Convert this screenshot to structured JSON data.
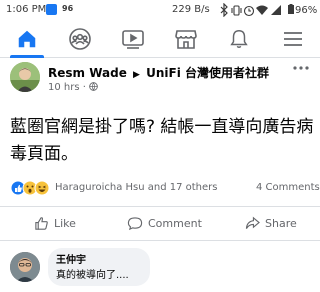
{
  "status_bar": {
    "time": "1:06 PM",
    "badge": "96",
    "speed": "229 B/s",
    "battery": "96%"
  },
  "nav": {
    "items": [
      {
        "name": "home-icon",
        "active": true
      },
      {
        "name": "groups-icon",
        "active": false
      },
      {
        "name": "watch-icon",
        "active": false
      },
      {
        "name": "marketplace-icon",
        "active": false
      },
      {
        "name": "notifications-icon",
        "active": false
      },
      {
        "name": "menu-icon",
        "active": false
      }
    ],
    "accent_color": "#1877f2"
  },
  "post": {
    "author": "Resm Wade",
    "group": "UniFi 台灣使用者社群",
    "time": "10 hrs",
    "separator": "·",
    "visibility_icon": "globe-icon",
    "text": "藍圈官網是掛了嗎? 結帳一直導向廣告病毒頁面。",
    "reactions": {
      "icons": [
        "like-icon",
        "wow-icon",
        "haha-icon"
      ],
      "names": "Haraguroicha Hsu and 17 others"
    },
    "comments_count": "4 Comments",
    "actions": {
      "like": "Like",
      "comment": "Comment",
      "share": "Share"
    }
  },
  "comment": {
    "author": "王仲宇",
    "text": "真的被導向了...."
  }
}
